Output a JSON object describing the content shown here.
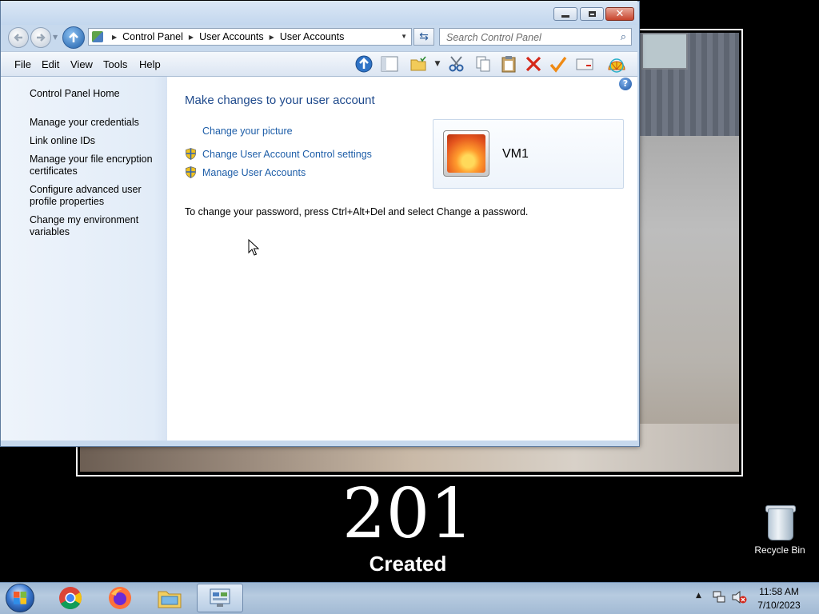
{
  "window": {
    "address": {
      "crumbs": [
        "Control Panel",
        "User Accounts",
        "User Accounts"
      ]
    },
    "search": {
      "placeholder": "Search Control Panel"
    },
    "menu": [
      "File",
      "Edit",
      "View",
      "Tools",
      "Help"
    ],
    "toolbar_icons": [
      "up-folder-icon",
      "layout-icon",
      "organize-folder-icon",
      "cut-icon",
      "copy-icon",
      "paste-icon",
      "delete-icon",
      "properties-check-icon",
      "mail-icon",
      "shell-icon"
    ],
    "left_pane": {
      "home": "Control Panel Home",
      "links": [
        "Manage your credentials",
        "Link online IDs",
        "Manage your file encryption certificates",
        "Configure advanced user profile properties",
        "Change my environment variables"
      ]
    },
    "main": {
      "heading": "Make changes to your user account",
      "tasks": [
        {
          "label": "Change your picture",
          "icon": ""
        },
        {
          "label": "Change User Account Control settings",
          "icon": "uac-shield-icon"
        },
        {
          "label": "Manage User Accounts",
          "icon": "uac-shield-icon"
        }
      ],
      "password_note": "To change your password, press Ctrl+Alt+Del and select Change a password.",
      "user": {
        "name": "VM1"
      }
    },
    "help_glyph": "?"
  },
  "desktop": {
    "wallpaper_number": "201",
    "wallpaper_caption": "Created",
    "icons": [
      {
        "label": "Recycle Bin",
        "icon": "recycle-bin-icon"
      }
    ]
  },
  "taskbar": {
    "apps": [
      "chrome-icon",
      "firefox-icon",
      "file-explorer-icon",
      "control-panel-icon"
    ],
    "clock": {
      "time": "11:58 AM",
      "date": "7/10/2023"
    },
    "tray_icons": [
      "show-hidden-icons-icon",
      "network-icon",
      "volume-muted-icon"
    ]
  },
  "colors": {
    "link": "#1e5ea8",
    "heading": "#1f4a8c",
    "close_button": "#c7432c"
  }
}
